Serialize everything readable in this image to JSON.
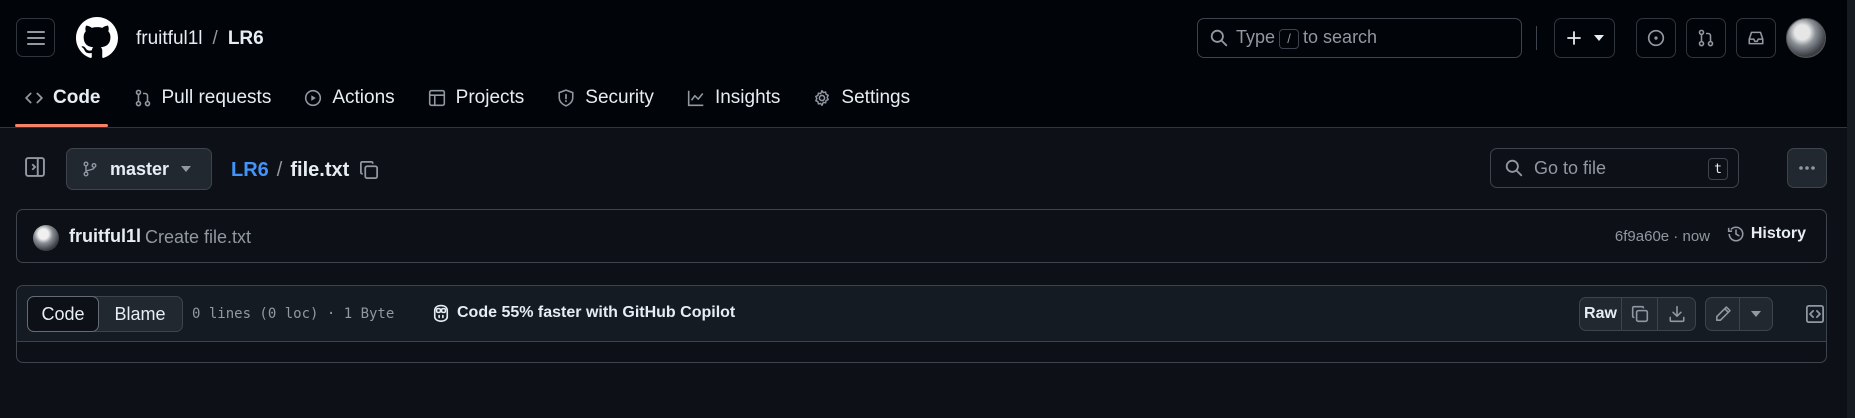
{
  "header": {
    "owner": "fruitful1l",
    "separator": "/",
    "repo": "LR6",
    "search": {
      "before": "Type",
      "key": "/",
      "after": "to search"
    }
  },
  "tabs": [
    {
      "label": "Code",
      "icon": "code-icon",
      "active": true
    },
    {
      "label": "Pull requests",
      "icon": "git-pull-request-icon"
    },
    {
      "label": "Actions",
      "icon": "play-icon"
    },
    {
      "label": "Projects",
      "icon": "table-icon"
    },
    {
      "label": "Security",
      "icon": "shield-icon"
    },
    {
      "label": "Insights",
      "icon": "graph-icon"
    },
    {
      "label": "Settings",
      "icon": "gear-icon"
    }
  ],
  "toolbar": {
    "branch": "master",
    "breadcrumb_repo": "LR6",
    "breadcrumb_sep": "/",
    "file_name": "file.txt",
    "goto_placeholder": "Go to file",
    "goto_key": "t"
  },
  "commit": {
    "author": "fruitful1l",
    "message": "Create file.txt",
    "meta": "6f9a60e · now",
    "history_label": "History"
  },
  "file": {
    "view_code": "Code",
    "view_blame": "Blame",
    "info": "0 lines (0 loc) · 1 Byte",
    "copilot": "Code 55% faster with GitHub Copilot",
    "raw_label": "Raw"
  },
  "colors": {
    "background": "#0d1117",
    "header_bg": "#010409",
    "accent_link": "#4493f8",
    "tab_underline": "#f78166",
    "border": "#3d444d"
  }
}
